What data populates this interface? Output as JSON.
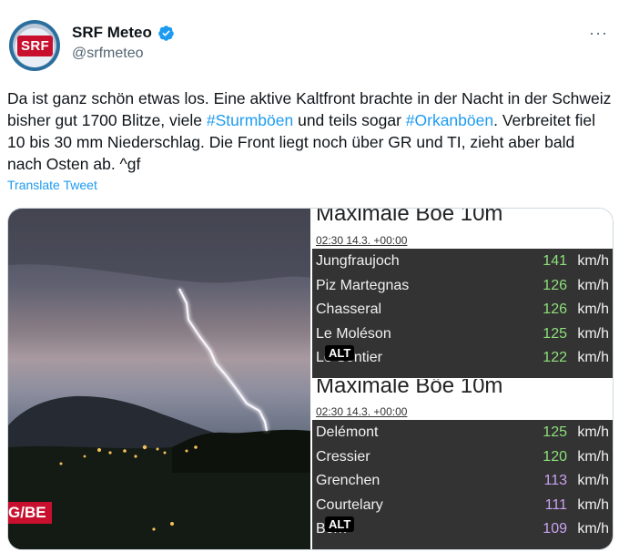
{
  "tweet": {
    "display_name": "SRF Meteo",
    "handle": "@srfmeteo",
    "avatar_text": "SRF",
    "more": "···",
    "text_parts": [
      {
        "t": "Da ist ganz schön etwas los. Eine aktive Kaltfront brachte in der Nacht in der Schweiz bisher gut 1700 Blitze, viele ",
        "tag": false
      },
      {
        "t": "#Sturmböen",
        "tag": true
      },
      {
        "t": " und teils sogar ",
        "tag": false
      },
      {
        "t": "#Orkanböen",
        "tag": true
      },
      {
        "t": ". Verbreitet fiel 10 bis 30 mm Niederschlag. Die Front liegt noch über GR und TI, zieht aber bald nach Osten ab. ^gf",
        "tag": false
      }
    ],
    "translate_label": "Translate Tweet"
  },
  "media": {
    "photo_label": "G/BE",
    "alt_label": "ALT",
    "panels": [
      {
        "title": "Maximale Böe 10m",
        "time": "02:30 14.3. +00:00",
        "rows": [
          {
            "station": "Jungfraujoch",
            "value": "141",
            "unit": "km/h",
            "color": "#8ee07a"
          },
          {
            "station": "Piz Martegnas",
            "value": "126",
            "unit": "km/h",
            "color": "#8ee07a"
          },
          {
            "station": "Chasseral",
            "value": "126",
            "unit": "km/h",
            "color": "#8ee07a"
          },
          {
            "station": "Le Moléson",
            "value": "125",
            "unit": "km/h",
            "color": "#8ee07a"
          },
          {
            "station": "Le Sentier",
            "value": "122",
            "unit": "km/h",
            "color": "#8ee07a"
          }
        ]
      },
      {
        "title": "Maximale Böe 10m",
        "time": "02:30 14.3. +00:00",
        "rows": [
          {
            "station": "Delémont",
            "value": "125",
            "unit": "km/h",
            "color": "#8ee07a"
          },
          {
            "station": "Cressier",
            "value": "120",
            "unit": "km/h",
            "color": "#8ee07a"
          },
          {
            "station": "Grenchen",
            "value": "113",
            "unit": "km/h",
            "color": "#c9a2f0"
          },
          {
            "station": "Courtelary",
            "value": "111",
            "unit": "km/h",
            "color": "#c9a2f0"
          },
          {
            "station": "Bern",
            "value": "109",
            "unit": "km/h",
            "color": "#c9a2f0"
          }
        ]
      }
    ]
  },
  "colors": {
    "link": "#1d9bf0",
    "srf_red": "#c8102e",
    "text": "#0f1419",
    "muted": "#536471"
  }
}
